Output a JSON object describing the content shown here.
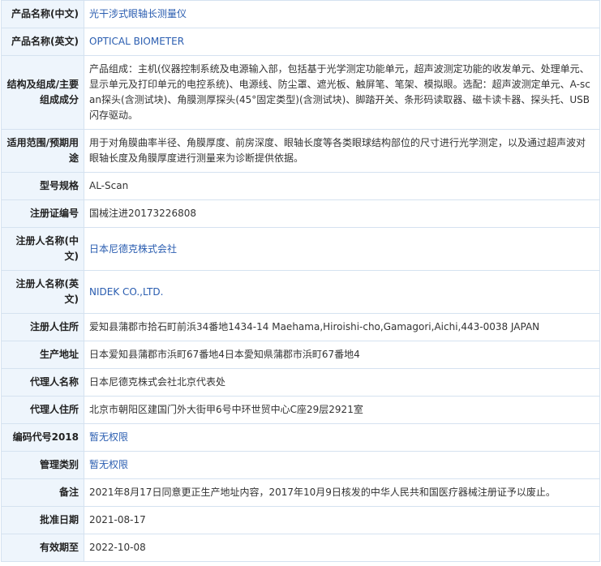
{
  "rows": [
    {
      "label": "产品名称(中文)",
      "value": "光干涉式眼轴长测量仪",
      "link": true
    },
    {
      "label": "产品名称(英文)",
      "value": "OPTICAL BIOMETER",
      "link": true
    },
    {
      "label": "结构及组成/主要组成成分",
      "value": "产品组成：主机(仪器控制系统及电源输入部，包括基于光学测定功能单元，超声波测定功能的收发单元、处理单元、显示单元及打印单元的电控系统)、电源线、防尘罩、遮光板、触屏笔、笔架、模拟眼。选配：超声波测定单元、A-scan探头(含测试块)、角膜测厚探头(45°固定类型)(含测试块)、脚踏开关、条形码读取器、磁卡读卡器、探头托、USB闪存驱动。",
      "link": false
    },
    {
      "label": "适用范围/预期用途",
      "value": "用于对角膜曲率半径、角膜厚度、前房深度、眼轴长度等各类眼球结构部位的尺寸进行光学测定，以及通过超声波对眼轴长度及角膜厚度进行测量来为诊断提供依据。",
      "link": false
    },
    {
      "label": "型号规格",
      "value": "AL-Scan",
      "link": false
    },
    {
      "label": "注册证编号",
      "value": "国械注进20173226808",
      "link": false
    },
    {
      "label": "注册人名称(中文)",
      "value": "日本尼德克株式会社",
      "link": true
    },
    {
      "label": "注册人名称(英文)",
      "value": "NIDEK CO.,LTD.",
      "link": true
    },
    {
      "label": "注册人住所",
      "value": "爱知县蒲郡市拾石町前浜34番地1434-14 Maehama,Hiroishi-cho,Gamagori,Aichi,443-0038 JAPAN",
      "link": false
    },
    {
      "label": "生产地址",
      "value": "日本爱知县蒲郡市浜町67番地4日本愛知県蒲郡市浜町67番地4",
      "link": false
    },
    {
      "label": "代理人名称",
      "value": "日本尼德克株式会社北京代表处",
      "link": false
    },
    {
      "label": "代理人住所",
      "value": "北京市朝阳区建国门外大街甲6号中环世贸中心C座29层2921室",
      "link": false
    },
    {
      "label": "编码代号2018",
      "value": "暂无权限",
      "link": true
    },
    {
      "label": "管理类别",
      "value": "暂无权限",
      "link": true
    },
    {
      "label": "备注",
      "value": "2021年8月17日同意更正生产地址内容，2017年10月9日核发的中华人民共和国医疗器械注册证予以废止。",
      "link": false
    },
    {
      "label": "批准日期",
      "value": "2021-08-17",
      "link": false
    },
    {
      "label": "有效期至",
      "value": "2022-10-08",
      "link": false
    }
  ]
}
